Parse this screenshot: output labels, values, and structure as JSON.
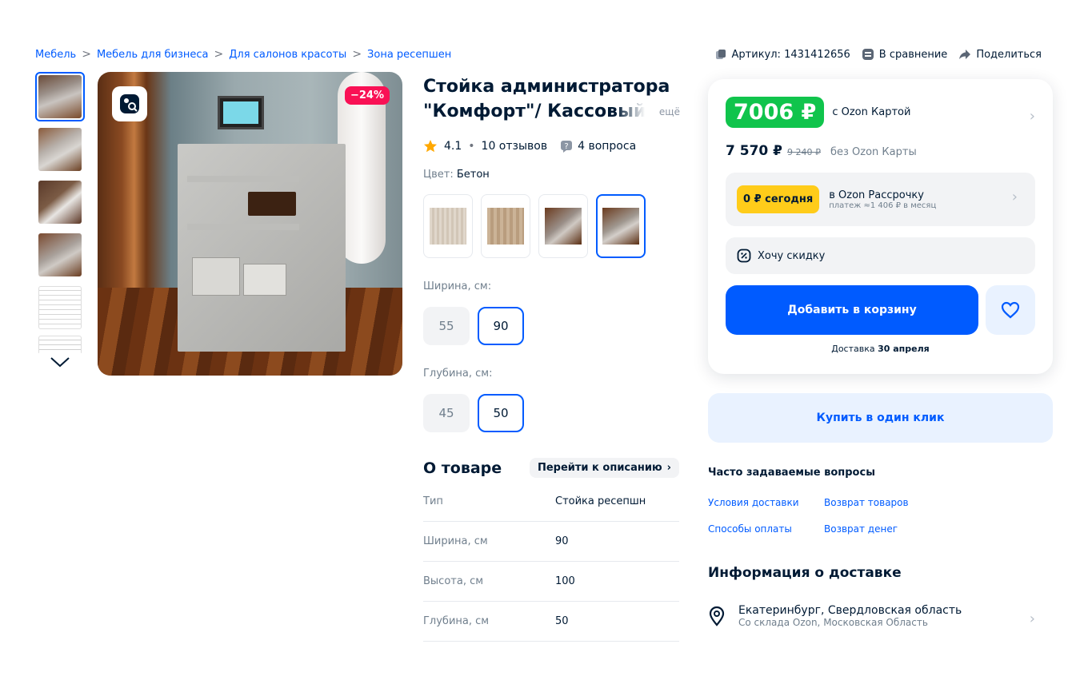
{
  "breadcrumb": [
    "Мебель",
    "Мебель для бизнеса",
    "Для салонов красоты",
    "Зона ресепшен"
  ],
  "top_actions": {
    "article": "Артикул: 1431412656",
    "compare": "В сравнение",
    "share": "Поделиться"
  },
  "gallery": {
    "discount_badge": "−24%",
    "thumb_count": 6
  },
  "product": {
    "title": "Стойка администратора \"Комфорт\"/ Кассовый",
    "more": "ещё",
    "rating": "4.1",
    "reviews": "10 отзывов",
    "questions": "4 вопроса",
    "color_label": "Цвет: ",
    "color_value": "Бетон",
    "width_label": "Ширина, см:",
    "width_options": [
      "55",
      "90"
    ],
    "width_selected": "90",
    "depth_label": "Глубина, см:",
    "depth_options": [
      "45",
      "50"
    ],
    "depth_selected": "50"
  },
  "about": {
    "title": "О товаре",
    "link": "Перейти к описанию",
    "specs": [
      {
        "k": "Тип",
        "v": "Стойка ресепшн"
      },
      {
        "k": "Ширина, см",
        "v": "90"
      },
      {
        "k": "Высота, см",
        "v": "100"
      },
      {
        "k": "Глубина, см",
        "v": "50"
      }
    ]
  },
  "pricing": {
    "card_price": "7006 ₽",
    "card_label": "с Ozon Картой",
    "price": "7 570 ₽",
    "old_price": "9 240 ₽",
    "no_card_label": "без Ozon Карты",
    "installment_badge": "0 ₽ сегодня",
    "installment_title": "в Ozon Рассрочку",
    "installment_sub": "платеж ≈1 406 ₽ в месяц",
    "want_discount": "Хочу скидку",
    "add_to_cart": "Добавить в корзину",
    "delivery_prefix": "Доставка ",
    "delivery_date": "30 апреля",
    "one_click": "Купить в один клик"
  },
  "faq": {
    "title": "Часто задаваемые вопросы",
    "links": [
      "Условия доставки",
      "Возврат товаров",
      "Способы оплаты",
      "Возврат денег"
    ]
  },
  "delivery_info": {
    "title": "Информация о доставке",
    "city": "Екатеринбург, Свердловская область",
    "warehouse": "Со склада Ozon, Московская Область"
  },
  "colors": {
    "accent": "#005bff",
    "price_green": "#10c44c",
    "installment_yellow": "#ffcc1a",
    "discount_pink": "#f91155"
  }
}
